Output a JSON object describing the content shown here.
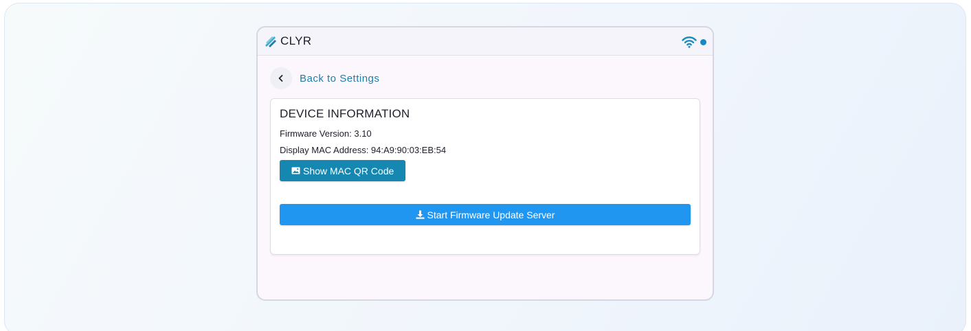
{
  "header": {
    "brand": "CLYR",
    "logo_icon": "clyr-logo-icon",
    "wifi_icon": "wifi-icon",
    "status_dot_color": "#1489c8"
  },
  "nav": {
    "back_icon": "chevron-left-icon",
    "back_label": "Back to Settings"
  },
  "device_info": {
    "title": "DEVICE INFORMATION",
    "firmware_line": "Firmware Version: 3.10",
    "mac_line": "Display MAC Address: 94:A9:90:03:EB:54",
    "qr_button": {
      "icon": "image-icon",
      "label": "Show MAC QR Code",
      "color": "#1687b0"
    },
    "update_button": {
      "icon": "download-icon",
      "label": "Start Firmware Update Server",
      "color": "#2196f0"
    }
  }
}
